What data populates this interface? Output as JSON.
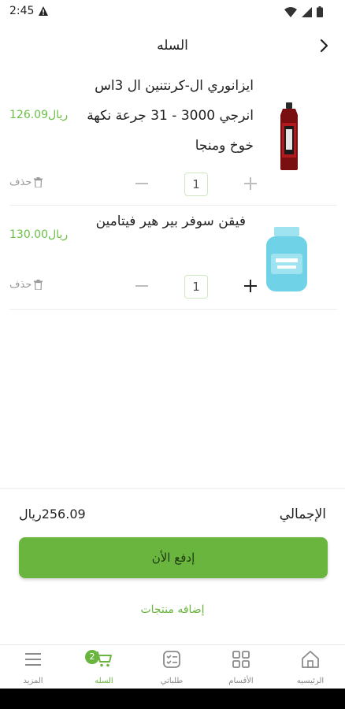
{
  "status": {
    "time": "2:45"
  },
  "header": {
    "title": "السله"
  },
  "items": [
    {
      "name": "ايزانوري ال-كرنتنين ال 3اس انرجي 3000 - 31 جرعة نكهة خوخ ومنجا",
      "price": "126.09ريال",
      "qty": "1",
      "delete_label": "حذف"
    },
    {
      "name": "فيقن سوفر بير هير فيتامين",
      "price": "130.00ريال",
      "qty": "1",
      "delete_label": "حذف"
    }
  ],
  "summary": {
    "total_label": "الإجمالي",
    "total_value": "256.09ريال"
  },
  "actions": {
    "pay_label": "إدفع الأن",
    "add_products_label": "إضافه منتجات"
  },
  "bottom_nav": {
    "items": [
      {
        "label": "المزيد",
        "icon": "menu-icon"
      },
      {
        "label": "السله",
        "icon": "cart-icon",
        "badge": "2"
      },
      {
        "label": "طلباتي",
        "icon": "orders-icon"
      },
      {
        "label": "الأقسام",
        "icon": "categories-icon"
      },
      {
        "label": "الرئيسيه",
        "icon": "home-icon"
      }
    ]
  },
  "colors": {
    "accent": "#6ab53e",
    "price": "#6abf45",
    "muted": "#8a8a8a"
  }
}
